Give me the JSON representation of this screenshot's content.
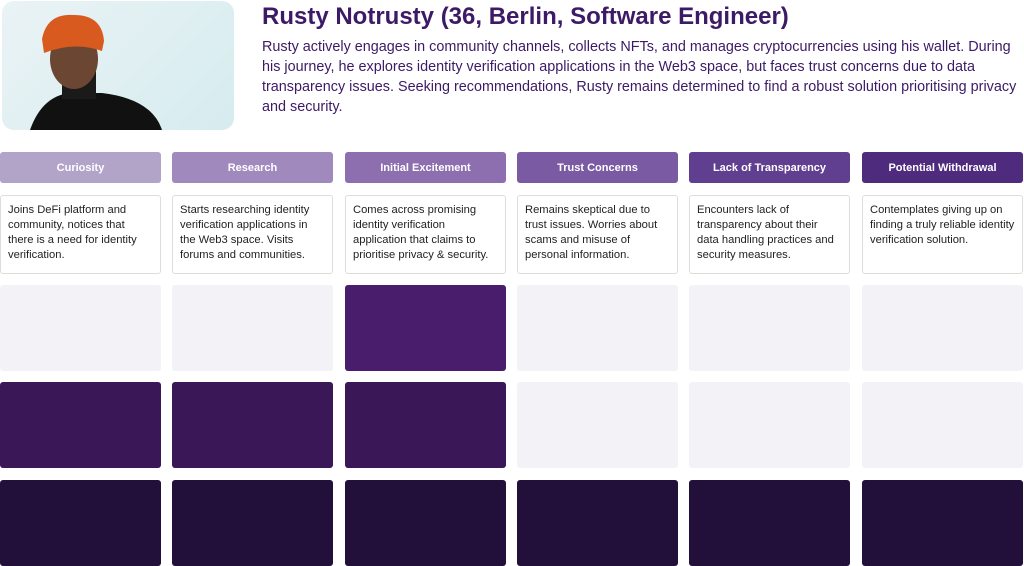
{
  "persona": {
    "title": "Rusty Notrusty (36, Berlin, Software Engineer)",
    "description": "Rusty actively engages in community channels, collects NFTs, and manages cryptocurrencies using his wallet. During his journey, he explores identity verification applications in the Web3 space, but faces trust concerns due to data transparency issues. Seeking recommendations, Rusty remains determined to find a robust solution prioritising privacy and security."
  },
  "stages": [
    {
      "label": "Curiosity",
      "color": "#b2a3c9",
      "text": "Joins DeFi platform and community, notices that there is a need for identity verification.",
      "levels": [
        false,
        true,
        true
      ]
    },
    {
      "label": "Research",
      "color": "#a08abd",
      "text": "Starts researching identity verification applications in the Web3 space. Visits forums and communities.",
      "levels": [
        false,
        true,
        true
      ]
    },
    {
      "label": "Initial Excitement",
      "color": "#8d6fb0",
      "text": "Comes across promising identity verification application that claims to prioritise privacy & security.",
      "levels": [
        true,
        true,
        true
      ]
    },
    {
      "label": "Trust Concerns",
      "color": "#7a5ba3",
      "text": "Remains skeptical due to trust issues. Worries about scams and misuse of personal information.",
      "levels": [
        false,
        false,
        true
      ]
    },
    {
      "label": "Lack of Transparency",
      "color": "#613f90",
      "text": "Encounters lack of transparency about their data handling practices and security measures.",
      "levels": [
        false,
        false,
        true
      ]
    },
    {
      "label": "Potential Withdrawal",
      "color": "#4e2b7c",
      "text": "Contemplates giving up on finding a truly reliable identity verification solution.",
      "levels": [
        false,
        false,
        true
      ]
    }
  ],
  "level_colors": [
    "#4a1c6c",
    "#3a1757",
    "#22103a"
  ]
}
